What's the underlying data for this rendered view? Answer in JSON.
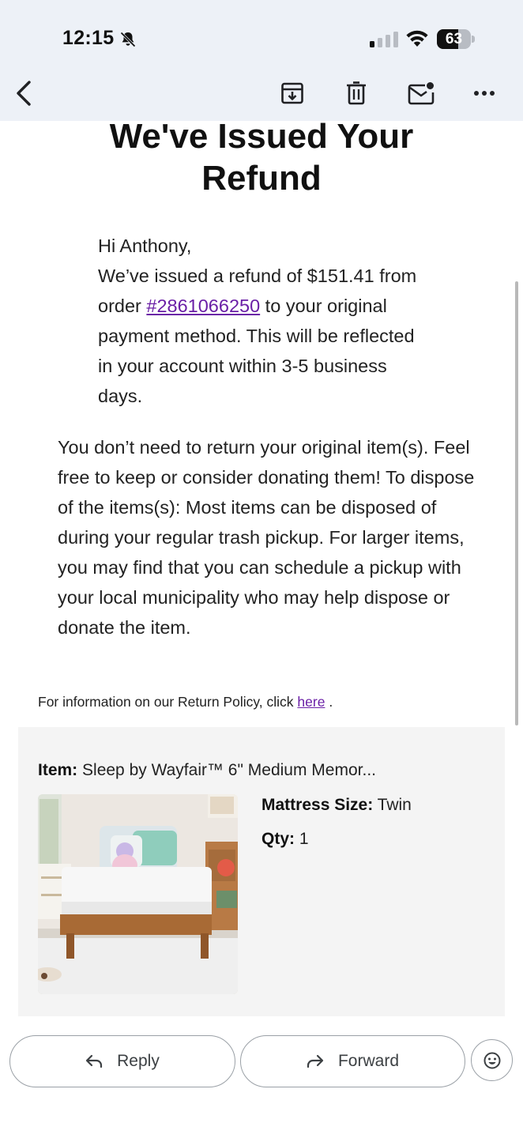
{
  "status_bar": {
    "time": "12:15",
    "battery": "63",
    "battery_level": 0.63
  },
  "toolbar": {
    "back_icon": "back-arrow-icon",
    "archive_icon": "archive-icon",
    "delete_icon": "trash-icon",
    "mark_unread_icon": "mark-unread-icon",
    "more_icon": "more-icon"
  },
  "email": {
    "headline": "We've Issued Your Refund",
    "greeting_name": "Hi Anthony,",
    "refund_text_1": "We’ve issued a refund of $151.41 from order ",
    "order_link": "#2861066250",
    "refund_text_2": " to your original payment method. This will be reflected in your account within 3-5 business days.",
    "disposal_text": "You don’t need to return your original item(s). Feel free to keep or consider donating them! To dispose of the items(s): Most items can be disposed of during your regular trash pickup. For larger items, you may find that you can schedule a pickup with your local municipality who may help dispose or donate the item.",
    "policy_text": "For information on our Return Policy, click ",
    "policy_link": "here",
    "policy_end": " ."
  },
  "item": {
    "item_label": "Item:",
    "item_name": " Sleep by Wayfair™ 6\" Medium Memor...",
    "size_label": "Mattress Size:",
    "size_value": " Twin",
    "qty_label": "Qty:",
    "qty_value": " 1"
  },
  "actions": {
    "reply_label": "Reply",
    "forward_label": "Forward",
    "emoji_icon": "add-reaction-icon"
  }
}
